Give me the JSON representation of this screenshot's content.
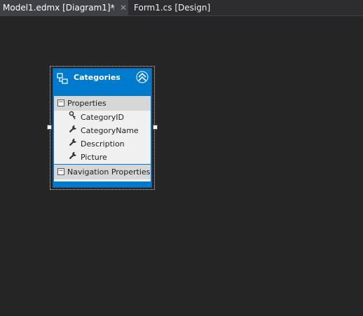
{
  "tabs": {
    "active": {
      "title": "Model1.edmx [Diagram1]*",
      "pin_icon": "⊣",
      "close_icon": "✕"
    },
    "inactive": {
      "title": "Form1.cs [Design]"
    }
  },
  "entity": {
    "name": "Categories",
    "icon": "entity-icon",
    "collapse_icon": "⌃⌃",
    "properties_header": "Properties",
    "properties": [
      {
        "name": "CategoryID",
        "icon": "key-icon"
      },
      {
        "name": "CategoryName",
        "icon": "wrench-icon"
      },
      {
        "name": "Description",
        "icon": "wrench-icon"
      },
      {
        "name": "Picture",
        "icon": "wrench-icon"
      }
    ],
    "navigation_header": "Navigation Properties"
  },
  "colors": {
    "entity_accent": "#007acc",
    "canvas": "#252526",
    "tab_active": "#3f3f46"
  }
}
